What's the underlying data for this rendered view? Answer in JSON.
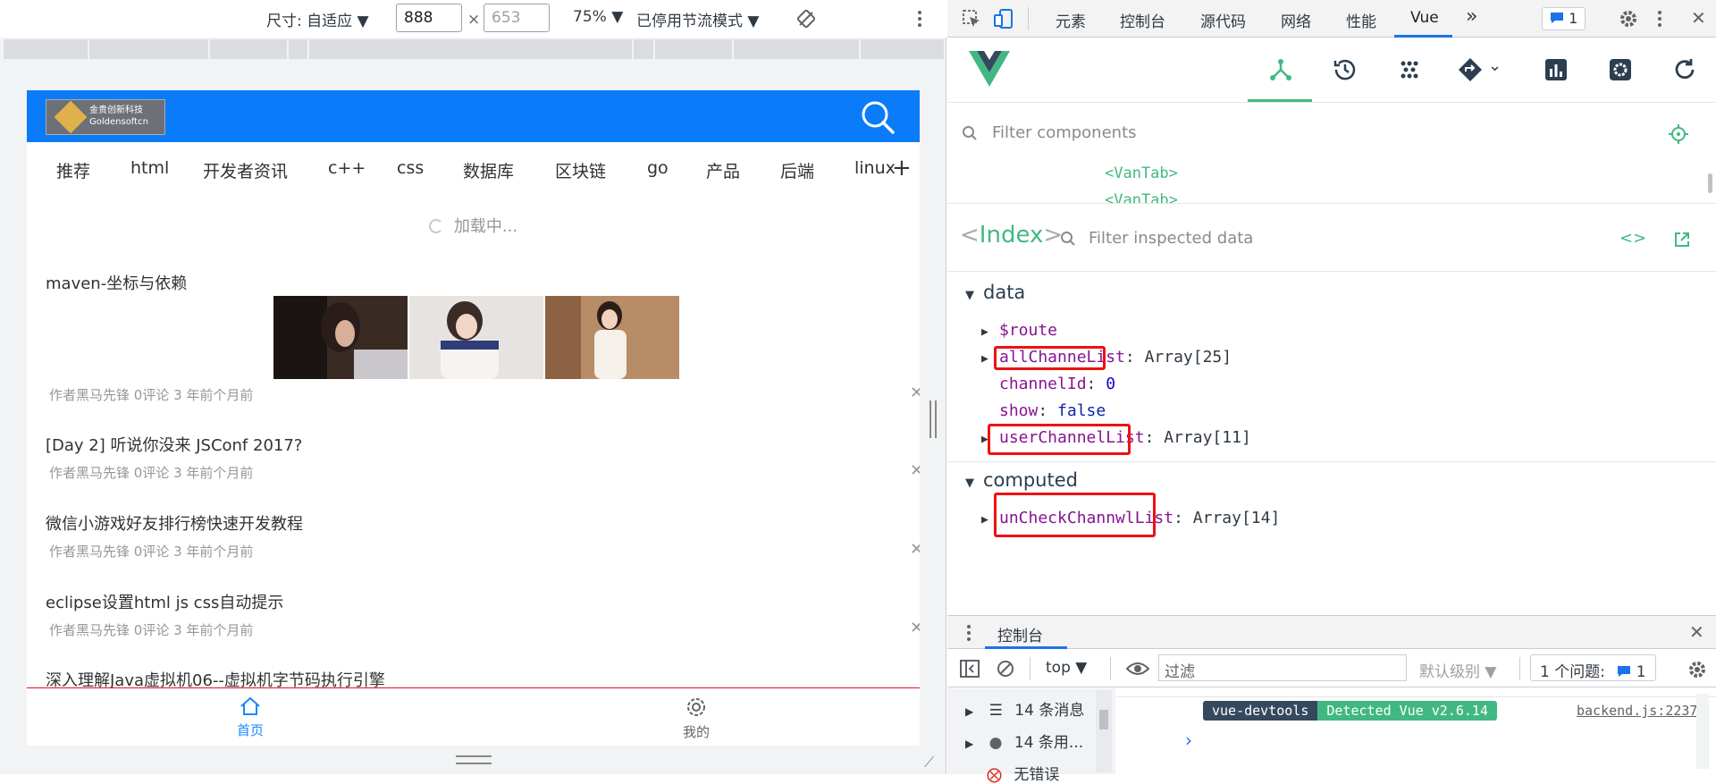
{
  "device_toolbar": {
    "size_label": "尺寸: 自适应 ▼",
    "width": "888",
    "times": "×",
    "height": "653",
    "zoom": "75% ▼",
    "throttle": "已停用节流模式 ▼"
  },
  "app": {
    "logo_cn": "金贵创新科技",
    "logo_en": "Goldensoftcn",
    "channels": [
      "推荐",
      "html",
      "开发者资讯",
      "c++",
      "css",
      "数据库",
      "区块链",
      "go",
      "产品",
      "后端",
      "linux"
    ],
    "loading": "加载中...",
    "articles": [
      {
        "title": "maven-坐标与依赖",
        "author": "作者黑马先锋",
        "comments": "0评论",
        "time": "3 年前个月前"
      },
      {
        "title": "[Day 2] 听说你没来 JSConf 2017?",
        "author": "作者黑马先锋",
        "comments": "0评论",
        "time": "3 年前个月前"
      },
      {
        "title": "微信小游戏好友排行榜快速开发教程",
        "author": "作者黑马先锋",
        "comments": "0评论",
        "time": "3 年前个月前"
      },
      {
        "title": "eclipse设置html js css自动提示",
        "author": "作者黑马先锋",
        "comments": "0评论",
        "time": "3 年前个月前"
      },
      {
        "title": "深入理解Java虚拟机06--虚拟机字节码执行引擎"
      }
    ],
    "tabbar": {
      "home": "首页",
      "mine": "我的"
    },
    "accent": "#0a7cfa"
  },
  "devtools": {
    "tabs": [
      "元素",
      "控制台",
      "源代码",
      "网络",
      "性能",
      "Vue"
    ],
    "more": "»",
    "issue_count": "1",
    "filter_components": "Filter components",
    "tree_items": [
      "<VanTab>",
      "<VanTab>"
    ],
    "inspected": {
      "component": "Index",
      "filter_placeholder": "Filter inspected data",
      "data_label": "data",
      "computed_label": "computed",
      "route": "$route",
      "allChanneList": "allChanneList",
      "allChanneList_val": "Array[25]",
      "channelId": "channelId",
      "channelId_val": "0",
      "show": "show",
      "show_val": "false",
      "userChannelList": "userChannelList",
      "userChannelList_val": "Array[11]",
      "unCheck": "unCheckChannwlList",
      "unCheck_val": "Array[14]"
    },
    "console": {
      "title": "控制台",
      "context": "top",
      "filter": "过滤",
      "level": "默认级别",
      "issues": "1 个问题:",
      "issues_count": "1",
      "side_messages": "14 条消息",
      "side_user": "14 条用...",
      "side_errors": "无错误",
      "badge_left": "vue-devtools",
      "badge_right": "Detected Vue v2.6.14",
      "source": "backend.js:2237",
      "prompt": "›"
    },
    "vue_green": "#42b983"
  }
}
